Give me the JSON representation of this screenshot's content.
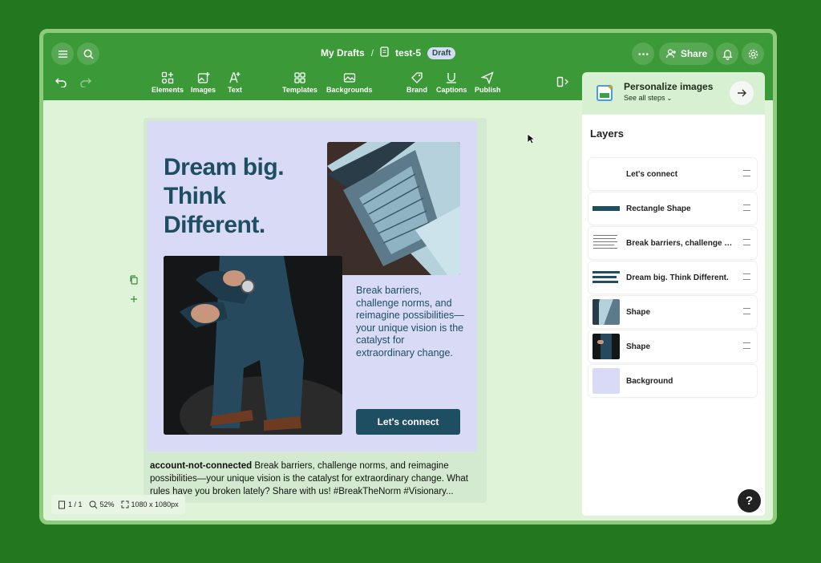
{
  "header": {
    "breadcrumb_root": "My Drafts",
    "separator": "/",
    "doc_name": "test-5",
    "status_badge": "Draft",
    "share_label": "Share"
  },
  "toolbar": {
    "tools": [
      {
        "label": "Elements",
        "icon": "elements-icon"
      },
      {
        "label": "Images",
        "icon": "images-icon"
      },
      {
        "label": "Text",
        "icon": "text-icon"
      },
      {
        "label": "Templates",
        "icon": "templates-icon"
      },
      {
        "label": "Backgrounds",
        "icon": "backgrounds-icon"
      },
      {
        "label": "Brand",
        "icon": "brand-icon"
      },
      {
        "label": "Captions",
        "icon": "captions-icon"
      },
      {
        "label": "Publish",
        "icon": "publish-icon"
      }
    ]
  },
  "design": {
    "headline": "Dream big. Think Different.",
    "body": "Break barriers, challenge norms, and reimagine possibilities—your unique vision is the catalyst for extraordinary change.",
    "cta": "Let's connect"
  },
  "caption": {
    "account": "account-not-connected",
    "text": " Break barriers, challenge norms, and reimagine possibilities—your unique vision is the catalyst for extraordinary change. What rules have you broken lately? Share with us! #BreakTheNorm #Visionary..."
  },
  "status_bar": {
    "pages": "1 / 1",
    "zoom": "52%",
    "size": "1080 x 1080px"
  },
  "personalize": {
    "title": "Personalize images",
    "subtitle": "See all steps"
  },
  "layers": {
    "title": "Layers",
    "items": [
      {
        "name": "Let's connect"
      },
      {
        "name": "Rectangle Shape"
      },
      {
        "name": "Break barriers, challenge norms, and reimagine possibilities"
      },
      {
        "name": "Dream big. Think Different."
      },
      {
        "name": "Shape"
      },
      {
        "name": "Shape"
      },
      {
        "name": "Background"
      }
    ]
  },
  "help_label": "?",
  "colors": {
    "brand_green": "#3b9a37",
    "design_bg": "#d8daf6",
    "headline": "#1e4e62",
    "cta_bg": "#1e4e62"
  }
}
